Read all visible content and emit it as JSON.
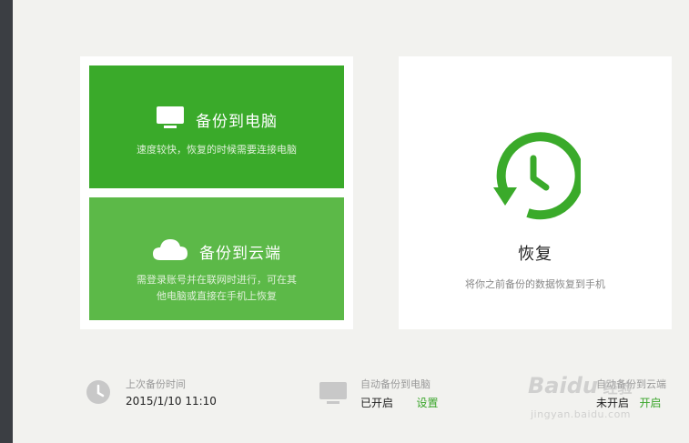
{
  "backup_pc": {
    "title": "备份到电脑",
    "desc": "速度较快，恢复的时候需要连接电脑"
  },
  "backup_cloud": {
    "title": "备份到云端",
    "desc_line1": "需登录账号并在联网时进行，可在其",
    "desc_line2": "他电脑或直接在手机上恢复"
  },
  "restore": {
    "title": "恢复",
    "desc": "将你之前备份的数据恢复到手机"
  },
  "status": {
    "last_backup": {
      "label": "上次备份时间",
      "value": "2015/1/10 11:10"
    },
    "auto_pc": {
      "label": "自动备份到电脑",
      "value": "已开启",
      "action": "设置"
    },
    "auto_cloud": {
      "label": "自动备份到云端",
      "value": "未开启",
      "action": "开启"
    }
  },
  "watermark": {
    "brand": "Baidu",
    "sub": "经验",
    "url": "jingyan.baidu.com"
  },
  "colors": {
    "green_dark": "#3aaa2a",
    "green_light": "#5cb948",
    "accent": "#3aa52a"
  },
  "icons": [
    "monitor-icon",
    "cloud-icon",
    "clock-restore-icon",
    "clock-icon",
    "monitor-status-icon"
  ]
}
